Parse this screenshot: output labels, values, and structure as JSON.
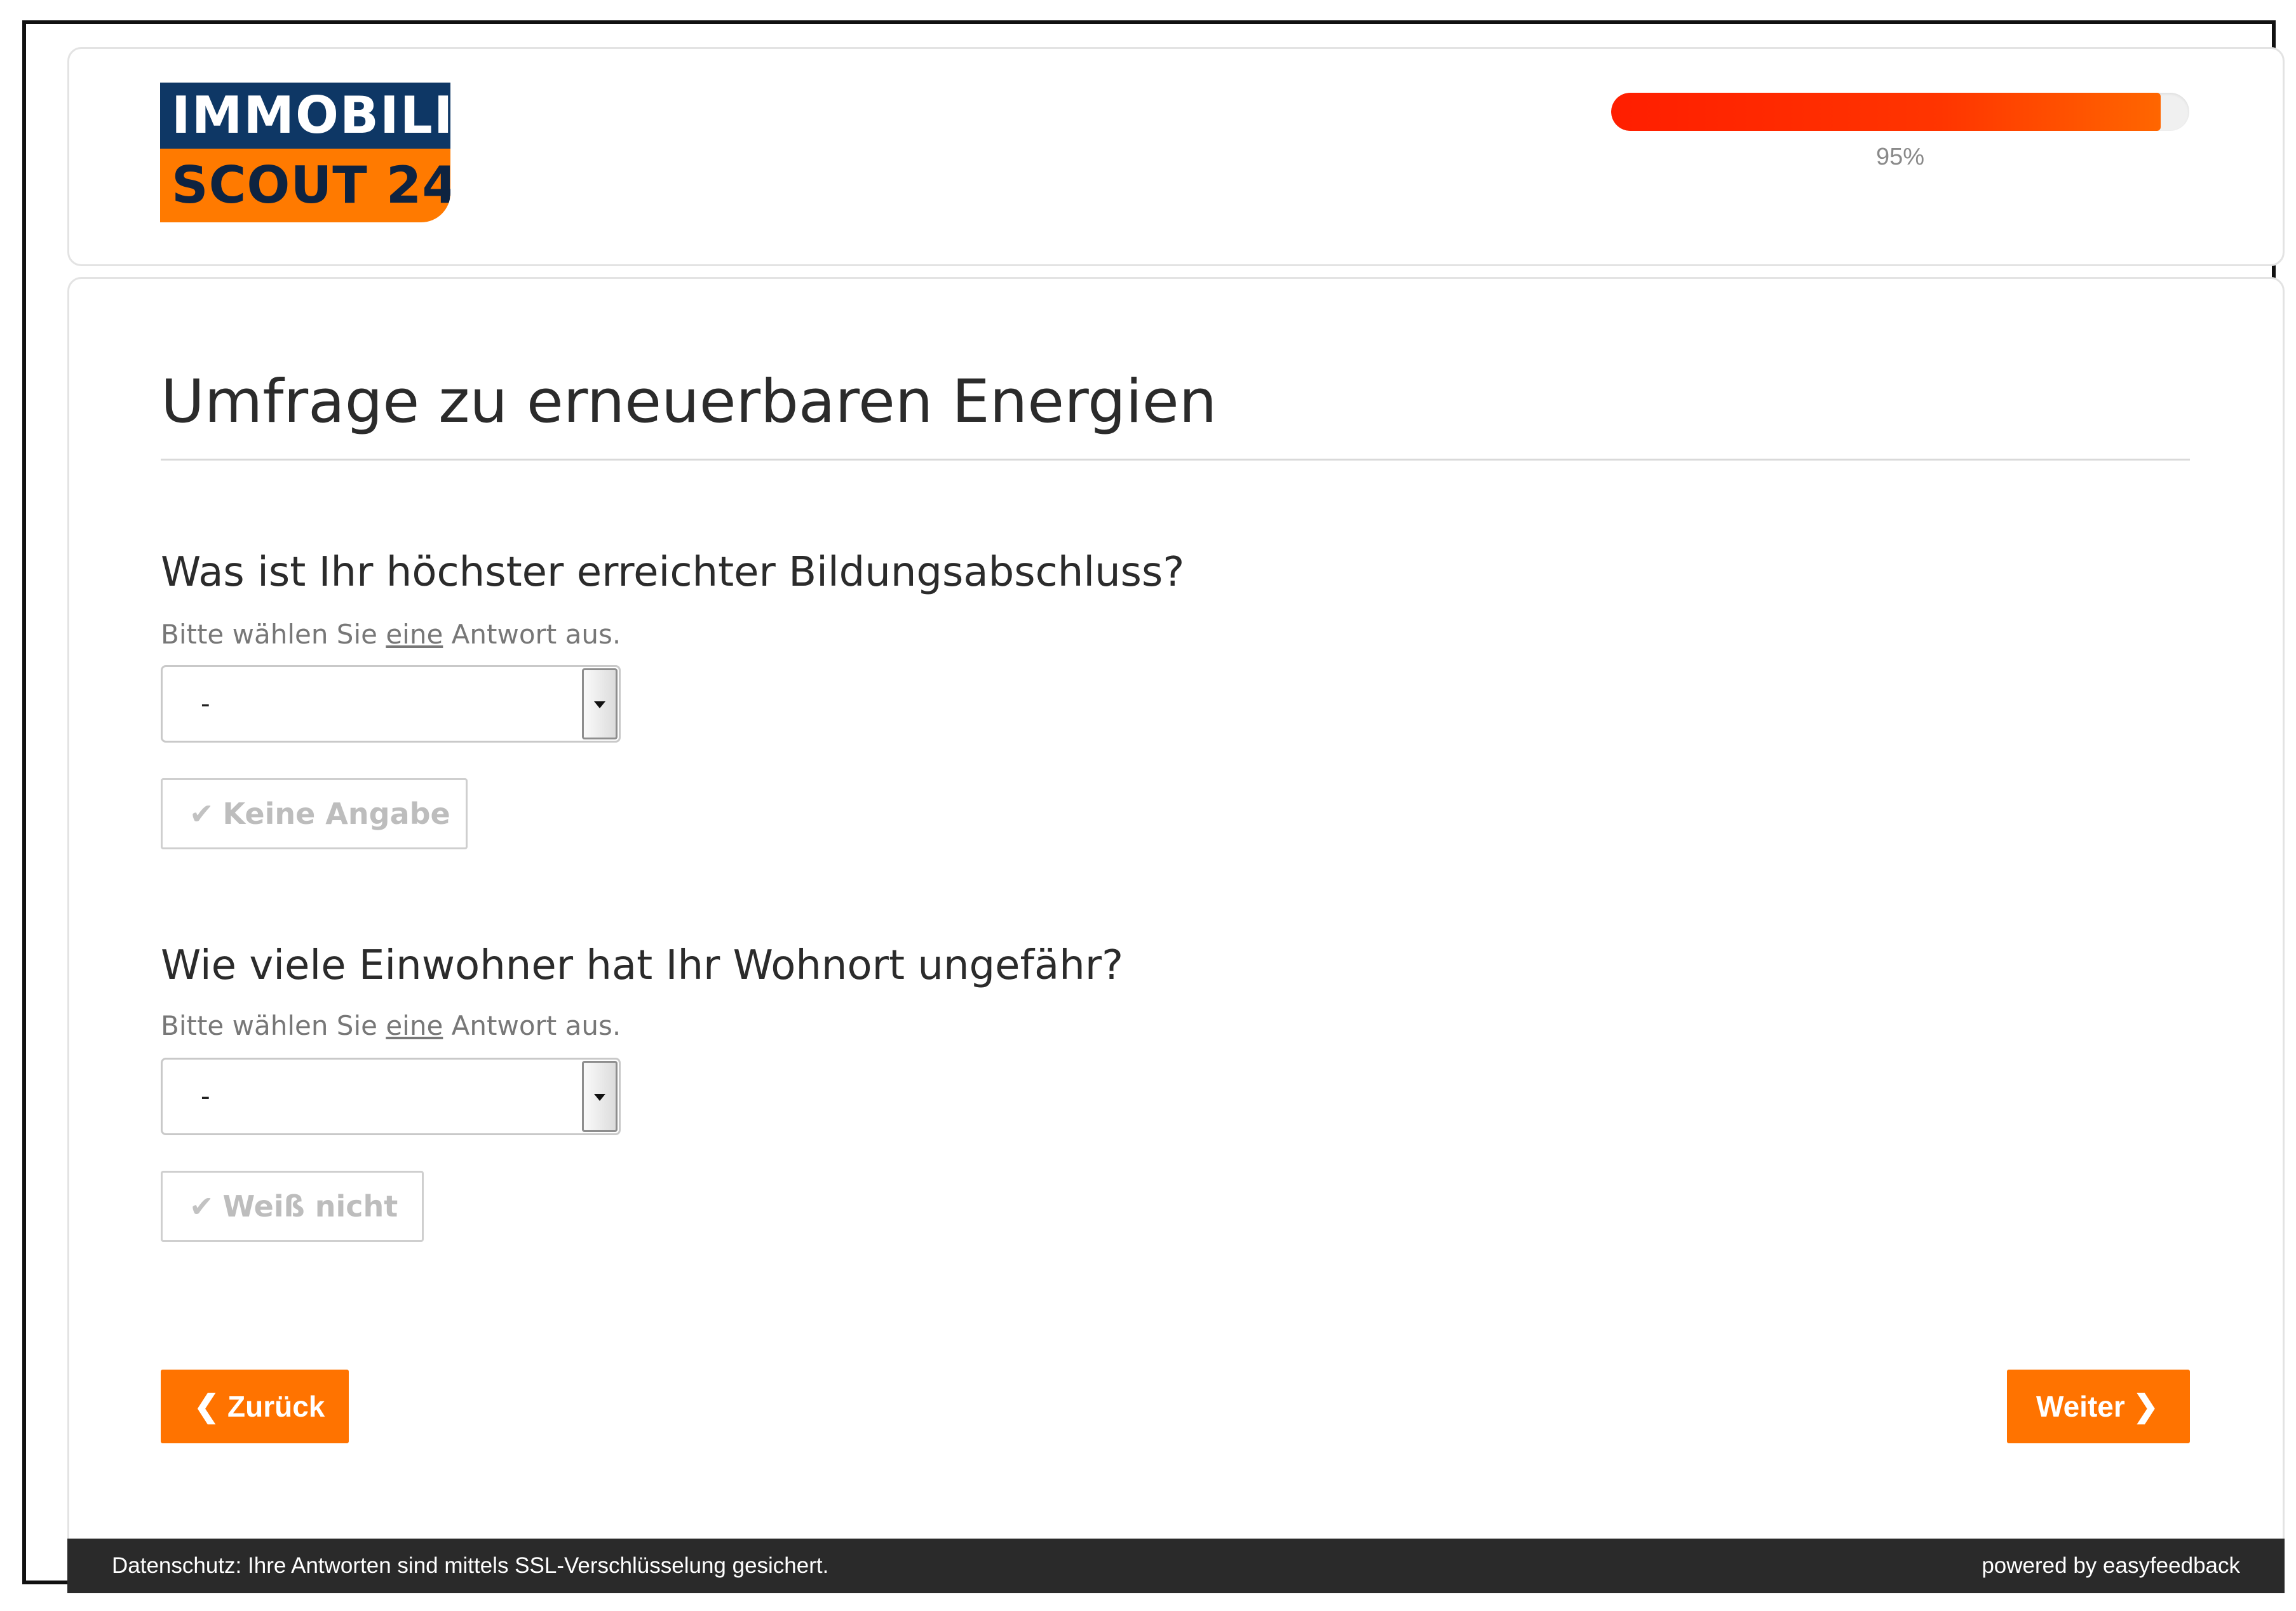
{
  "logo": {
    "line1": "IMMOBILIEN",
    "line2": "SCOUT 24",
    "colors": {
      "navy": "#0e3765",
      "orange": "#ff7a00"
    }
  },
  "progress": {
    "value": 0.95,
    "label": "95%",
    "fill_color": "#ff3300"
  },
  "page_title": "Umfrage zu erneuerbaren Energien",
  "questions": [
    {
      "text": "Was ist Ihr höchster erreichter Bildungsabschluss?",
      "hint_before": "Bitte wählen Sie ",
      "hint_emphasis": "eine",
      "hint_after": " Antwort aus.",
      "select_value": "-",
      "option_button": "Keine Angabe",
      "option_icon": "check-icon"
    },
    {
      "text": "Wie viele Einwohner hat Ihr Wohnort ungefähr?",
      "hint_before": "Bitte wählen Sie ",
      "hint_emphasis": "eine",
      "hint_after": " Antwort aus.",
      "select_value": "-",
      "option_button": "Weiß nicht",
      "option_icon": "check-icon"
    }
  ],
  "navigation": {
    "back_label": "Zurück",
    "back_icon": "chevron-left-icon",
    "next_label": "Weiter",
    "next_icon": "chevron-right-icon",
    "button_color": "#ff7300"
  },
  "footer": {
    "privacy_text": "Datenschutz: Ihre Antworten sind mittels SSL-Verschlüsselung gesichert.",
    "powered_by": "powered by easyfeedback",
    "background": "#2a2a2a"
  }
}
